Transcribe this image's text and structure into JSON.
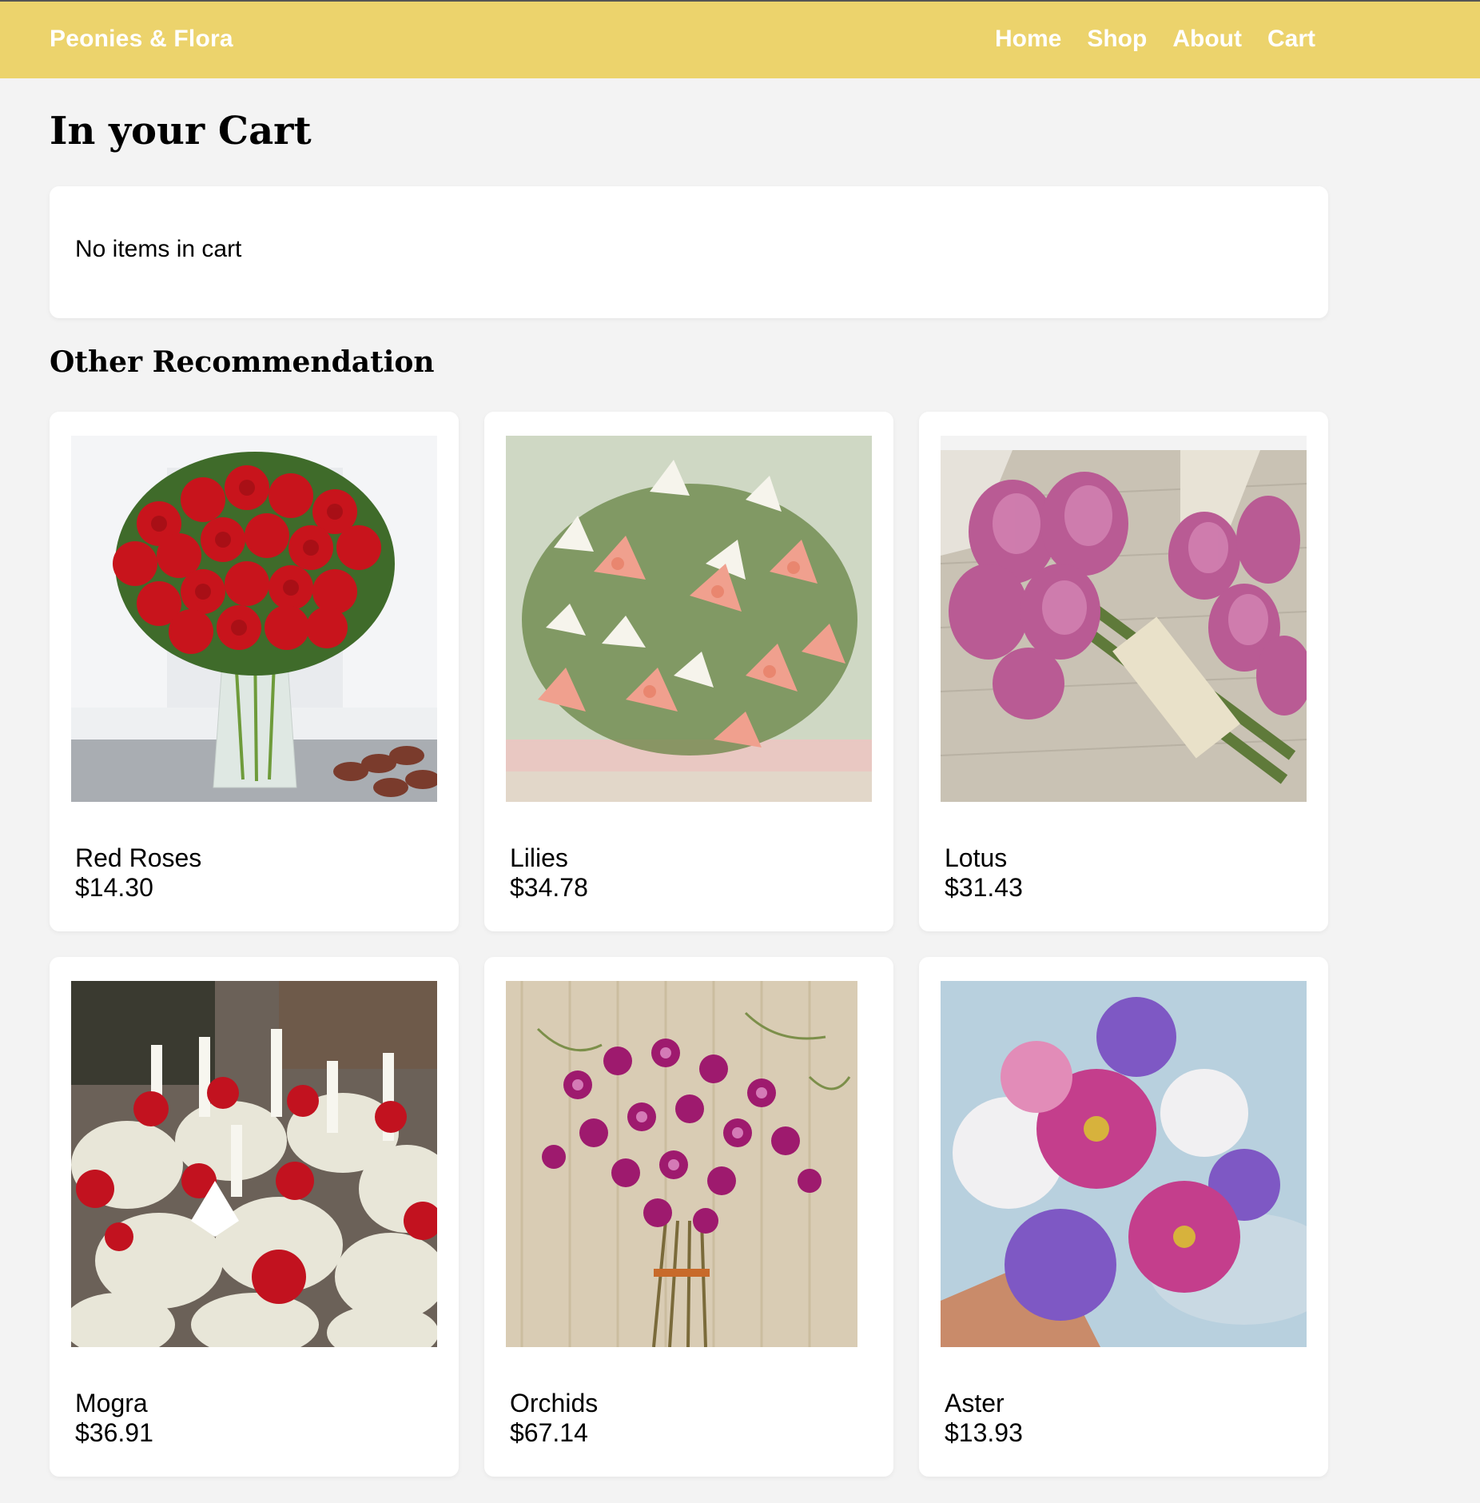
{
  "nav": {
    "brand": "Peonies & Flora",
    "links": [
      "Home",
      "Shop",
      "About",
      "Cart"
    ]
  },
  "cart": {
    "title": "In your Cart",
    "empty_message": "No items in cart"
  },
  "recommendations": {
    "title": "Other Recommendation",
    "items": [
      {
        "name": "Red Roses",
        "price": "$14.30"
      },
      {
        "name": "Lilies",
        "price": "$34.78"
      },
      {
        "name": "Lotus",
        "price": "$31.43"
      },
      {
        "name": "Mogra",
        "price": "$36.91"
      },
      {
        "name": "Orchids",
        "price": "$67.14"
      },
      {
        "name": "Aster",
        "price": "$13.93"
      }
    ]
  },
  "colors": {
    "navbar": "#ecd36c",
    "background": "#f3f3f3",
    "card": "#ffffff"
  }
}
